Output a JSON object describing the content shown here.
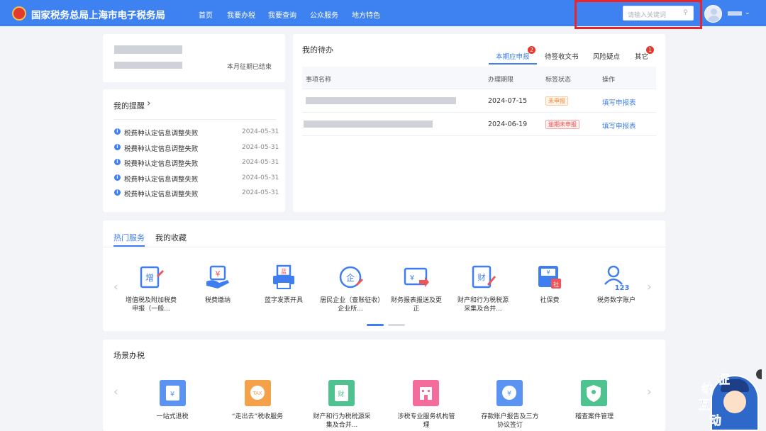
{
  "header": {
    "brand": "国家税务总局上海市电子税务局",
    "nav": [
      "首页",
      "我要办税",
      "我要查询",
      "公众服务",
      "地方特色"
    ],
    "search_placeholder": "请输入关键词"
  },
  "profile": {
    "status": "本月征期已结束"
  },
  "reminders": {
    "title": "我的提醒",
    "chevron": "›",
    "items": [
      {
        "text": "税费种认定信息调整失败",
        "date": "2024-05-31"
      },
      {
        "text": "税费种认定信息调整失败",
        "date": "2024-05-31"
      },
      {
        "text": "税费种认定信息调整失败",
        "date": "2024-05-31"
      },
      {
        "text": "税费种认定信息调整失败",
        "date": "2024-05-31"
      },
      {
        "text": "税费种认定信息调整失败",
        "date": "2024-05-31"
      }
    ]
  },
  "todo": {
    "title": "我的待办",
    "tabs": [
      {
        "label": "本期应申报",
        "badge": "2"
      },
      {
        "label": "待签收文书",
        "badge": ""
      },
      {
        "label": "风险疑点",
        "badge": ""
      },
      {
        "label": "其它",
        "badge": "1"
      }
    ],
    "columns": [
      "事项名称",
      "办理期限",
      "标签状态",
      "操作"
    ],
    "rows": [
      {
        "deadline": "2024-07-15",
        "status": "未申报",
        "action": "填写申报表"
      },
      {
        "deadline": "2024-06-19",
        "status": "逾期未申报",
        "action": "填写申报表"
      }
    ]
  },
  "services": {
    "tabs": [
      "热门服务",
      "我的收藏"
    ],
    "items": [
      {
        "label": "增值税及附加税费申报（一般...",
        "icon": "vat-declare-icon"
      },
      {
        "label": "税费缴纳",
        "icon": "tax-payment-icon"
      },
      {
        "label": "蓝字发票开具",
        "icon": "invoice-print-icon"
      },
      {
        "label": "居民企业（查账征收）企业所...",
        "icon": "enterprise-income-icon"
      },
      {
        "label": "财务报表报送及更正",
        "icon": "financial-report-icon"
      },
      {
        "label": "财产和行为税税源采集及合并...",
        "icon": "property-tax-icon"
      },
      {
        "label": "社保费",
        "icon": "social-security-icon"
      },
      {
        "label": "税务数字账户",
        "icon": "digital-account-icon"
      }
    ],
    "prev": "‹",
    "next": "›"
  },
  "scenes": {
    "title": "场景办税",
    "items": [
      {
        "label": "一站式退税",
        "icon": "refund-icon"
      },
      {
        "label": "“走出去”税收服务",
        "icon": "tax-going-out-icon"
      },
      {
        "label": "财产和行为税税源采集及合并...",
        "icon": "property-tax-icon"
      },
      {
        "label": "涉税专业服务机构管理",
        "icon": "agency-icon"
      },
      {
        "label": "存款账户报告及三方协议签订",
        "icon": "bank-account-icon"
      },
      {
        "label": "稽查案件管理",
        "icon": "inspection-icon"
      }
    ],
    "prev": "‹",
    "next": "›"
  },
  "mascot": {
    "chars": [
      "征",
      "纳",
      "互",
      "动"
    ]
  },
  "colors": {
    "nav": "#3e82f1",
    "accent": "#3e7ef0",
    "badge": "#e9372d",
    "status_pending_text": "#f5883c",
    "status_pending_bg": "#fff4e8",
    "status_overdue_text": "#ef4f4f",
    "status_overdue_bg": "#fff0f0",
    "highlight_box": "#e8252b"
  }
}
